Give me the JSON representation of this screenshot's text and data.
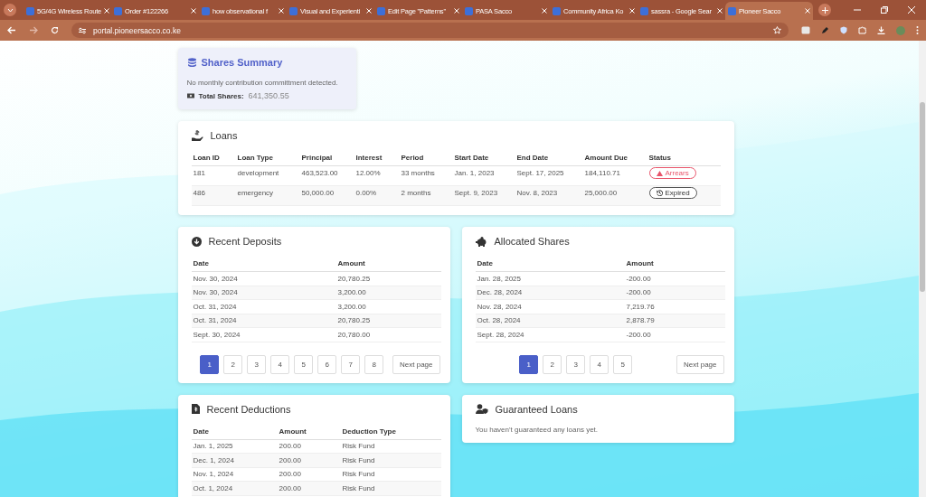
{
  "browser": {
    "tabs": [
      {
        "title": "5G/4G Wireless Route",
        "selected": false
      },
      {
        "title": "Order #122266",
        "selected": false
      },
      {
        "title": "how observational f",
        "selected": false
      },
      {
        "title": "Visual and Experienti",
        "selected": false
      },
      {
        "title": "Edit Page \"Patterns\"",
        "selected": false
      },
      {
        "title": "PASA Sacco",
        "selected": false
      },
      {
        "title": "Community Africa Ko",
        "selected": false
      },
      {
        "title": "sassra - Google Sear",
        "selected": false
      },
      {
        "title": "Pioneer Sacco",
        "selected": true
      }
    ],
    "address": "portal.pioneersacco.co.ke"
  },
  "shares_summary": {
    "title": "Shares Summary",
    "note": "No monthly contribution committment detected.",
    "total_label": "Total Shares:",
    "total_value": "641,350.55"
  },
  "loans": {
    "title": "Loans",
    "columns": [
      "Loan ID",
      "Loan Type",
      "Principal",
      "Interest",
      "Period",
      "Start Date",
      "End Date",
      "Amount Due",
      "Status"
    ],
    "rows": [
      {
        "cells": [
          "181",
          "development",
          "463,523.00",
          "12.00%",
          "33 months",
          "Jan. 1, 2023",
          "Sept. 17, 2025",
          "184,110.71"
        ],
        "status": {
          "label": "Arrears",
          "kind": "arrears"
        }
      },
      {
        "cells": [
          "486",
          "emergency",
          "50,000.00",
          "0.00%",
          "2 months",
          "Sept. 9, 2023",
          "Nov. 8, 2023",
          "25,000.00"
        ],
        "status": {
          "label": "Expired",
          "kind": "expired"
        }
      }
    ]
  },
  "recent_deposits": {
    "title": "Recent Deposits",
    "columns": [
      "Date",
      "Amount"
    ],
    "rows": [
      [
        "Nov. 30, 2024",
        "20,780.25"
      ],
      [
        "Nov. 30, 2024",
        "3,200.00"
      ],
      [
        "Oct. 31, 2024",
        "3,200.00"
      ],
      [
        "Oct. 31, 2024",
        "20,780.25"
      ],
      [
        "Sept. 30, 2024",
        "20,780.00"
      ]
    ],
    "pages": [
      {
        "label": "1",
        "selected": true
      },
      {
        "label": "2",
        "selected": false
      },
      {
        "label": "3",
        "selected": false
      },
      {
        "label": "4",
        "selected": false
      },
      {
        "label": "5",
        "selected": false
      },
      {
        "label": "6",
        "selected": false
      },
      {
        "label": "7",
        "selected": false
      },
      {
        "label": "8",
        "selected": false
      }
    ],
    "next_label": "Next page"
  },
  "allocated_shares": {
    "title": "Allocated Shares",
    "columns": [
      "Date",
      "Amount"
    ],
    "rows": [
      [
        "Jan. 28, 2025",
        "-200.00"
      ],
      [
        "Dec. 28, 2024",
        "-200.00"
      ],
      [
        "Nov. 28, 2024",
        "7,219.76"
      ],
      [
        "Oct. 28, 2024",
        "2,878.79"
      ],
      [
        "Sept. 28, 2024",
        "-200.00"
      ]
    ],
    "pages": [
      {
        "label": "1",
        "selected": true
      },
      {
        "label": "2",
        "selected": false
      },
      {
        "label": "3",
        "selected": false
      },
      {
        "label": "4",
        "selected": false
      },
      {
        "label": "5",
        "selected": false
      }
    ],
    "next_label": "Next page"
  },
  "recent_deductions": {
    "title": "Recent Deductions",
    "columns": [
      "Date",
      "Amount",
      "Deduction Type"
    ],
    "rows": [
      [
        "Jan. 1, 2025",
        "200.00",
        "Risk Fund"
      ],
      [
        "Dec. 1, 2024",
        "200.00",
        "Risk Fund"
      ],
      [
        "Nov. 1, 2024",
        "200.00",
        "Risk Fund"
      ],
      [
        "Oct. 1, 2024",
        "200.00",
        "Risk Fund"
      ]
    ]
  },
  "guaranteed_loans": {
    "title": "Guaranteed Loans",
    "message": "You haven't guaranteed any loans yet."
  }
}
